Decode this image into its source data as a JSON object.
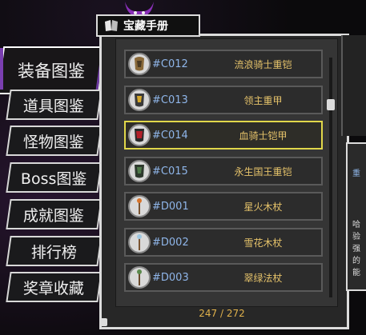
{
  "book_title": "宝藏手册",
  "categories": [
    {
      "label": "装备图鉴",
      "active": true
    },
    {
      "label": "道具图鉴",
      "active": false
    },
    {
      "label": "怪物图鉴",
      "active": false
    },
    {
      "label": "Boss图鉴",
      "active": false
    },
    {
      "label": "成就图鉴",
      "active": false
    },
    {
      "label": "排行榜",
      "active": false
    },
    {
      "label": "奖章收藏",
      "active": false
    }
  ],
  "items": [
    {
      "code": "#C012",
      "name": "流浪骑士重铠",
      "icon": "armor-icon",
      "selected": false
    },
    {
      "code": "#C013",
      "name": "领主重甲",
      "icon": "armor-icon",
      "selected": false
    },
    {
      "code": "#C014",
      "name": "血骑士铠甲",
      "icon": "armor-icon",
      "selected": true
    },
    {
      "code": "#C015",
      "name": "永生国王重铠",
      "icon": "armor-icon",
      "selected": false
    },
    {
      "code": "#D001",
      "name": "星火木杖",
      "icon": "staff-icon",
      "selected": false
    },
    {
      "code": "#D002",
      "name": "雪花木杖",
      "icon": "staff-icon",
      "selected": false
    },
    {
      "code": "#D003",
      "name": "翠绿法杖",
      "icon": "staff-icon",
      "selected": false
    }
  ],
  "counter": "247 / 272",
  "detail_clip": {
    "label_top": "重",
    "lines": [
      "哈",
      "验",
      "强",
      "的",
      "能"
    ]
  },
  "colors": {
    "code": "#8fb6ea",
    "name": "#e5c26a",
    "selected_border": "#e1d74a",
    "accent": "#7a3fb0"
  }
}
